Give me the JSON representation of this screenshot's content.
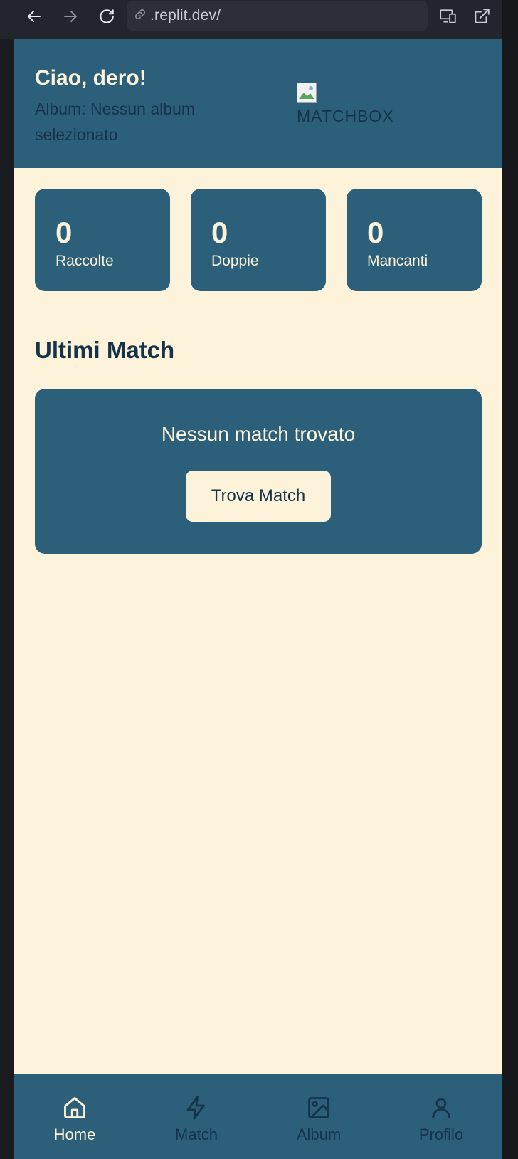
{
  "browser": {
    "url": ".replit.dev/"
  },
  "header": {
    "greeting": "Ciao, dero!",
    "album_label": "Album: Nessun album selezionato",
    "logo_alt": "MATCHBOX"
  },
  "stats": [
    {
      "value": "0",
      "label": "Raccolte"
    },
    {
      "value": "0",
      "label": "Doppie"
    },
    {
      "value": "0",
      "label": "Mancanti"
    }
  ],
  "matches": {
    "title": "Ultimi Match",
    "empty_message": "Nessun match trovato",
    "button_label": "Trova Match"
  },
  "bottom_nav": {
    "items": [
      {
        "label": "Home",
        "icon": "home-icon",
        "active": true
      },
      {
        "label": "Match",
        "icon": "bolt-icon",
        "active": false
      },
      {
        "label": "Album",
        "icon": "image-icon",
        "active": false
      },
      {
        "label": "Profilo",
        "icon": "user-icon",
        "active": false
      }
    ]
  },
  "colors": {
    "primary": "#2c5f79",
    "background": "#fcf3da",
    "text_dark": "#16334a"
  }
}
